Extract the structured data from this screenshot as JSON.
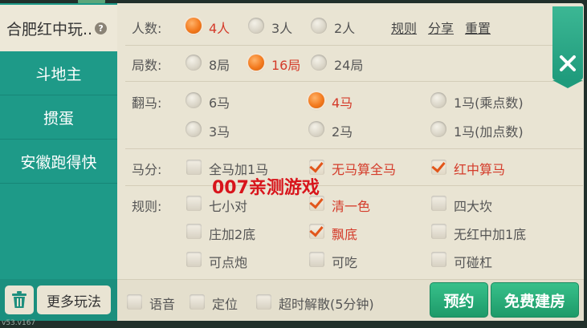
{
  "version": "v53.v167",
  "sidebar": {
    "active": "合肥红中玩..",
    "items": [
      "斗地主",
      "掼蛋",
      "安徽跑得快"
    ],
    "more": "更多玩法"
  },
  "links": {
    "rules": "规则",
    "share": "分享",
    "reset": "重置"
  },
  "players": {
    "label": "人数:",
    "options": [
      "4人",
      "3人",
      "2人"
    ],
    "selected": 0
  },
  "rounds": {
    "label": "局数:",
    "options": [
      "8局",
      "16局",
      "24局"
    ],
    "selected": 1
  },
  "fanma": {
    "label": "翻马:",
    "options": [
      "6马",
      "4马",
      "1马(乘点数)",
      "3马",
      "2马",
      "1马(加点数)"
    ],
    "selected": 1
  },
  "mafen": {
    "label": "马分:",
    "options": [
      "全马加1马",
      "无马算全马",
      "红中算马"
    ],
    "checked": [
      false,
      true,
      true
    ]
  },
  "rules": {
    "label": "规则:",
    "options": [
      "七小对",
      "清一色",
      "四大坎",
      "庄加2底",
      "飘底",
      "无红中加1底",
      "可点炮",
      "可吃",
      "可碰杠"
    ],
    "checked": [
      false,
      true,
      false,
      false,
      true,
      false,
      false,
      false,
      false
    ]
  },
  "bottom": {
    "options": [
      "语音",
      "定位",
      "超时解散(5分钟)"
    ],
    "reserve": "预约",
    "create": "免费建房"
  },
  "watermark": "007亲测游戏",
  "colors": {
    "accent": "#f37a1e",
    "selected_text": "#d43b2a",
    "sidebar": "#1e9a88",
    "button_green": "#1e9a69"
  }
}
